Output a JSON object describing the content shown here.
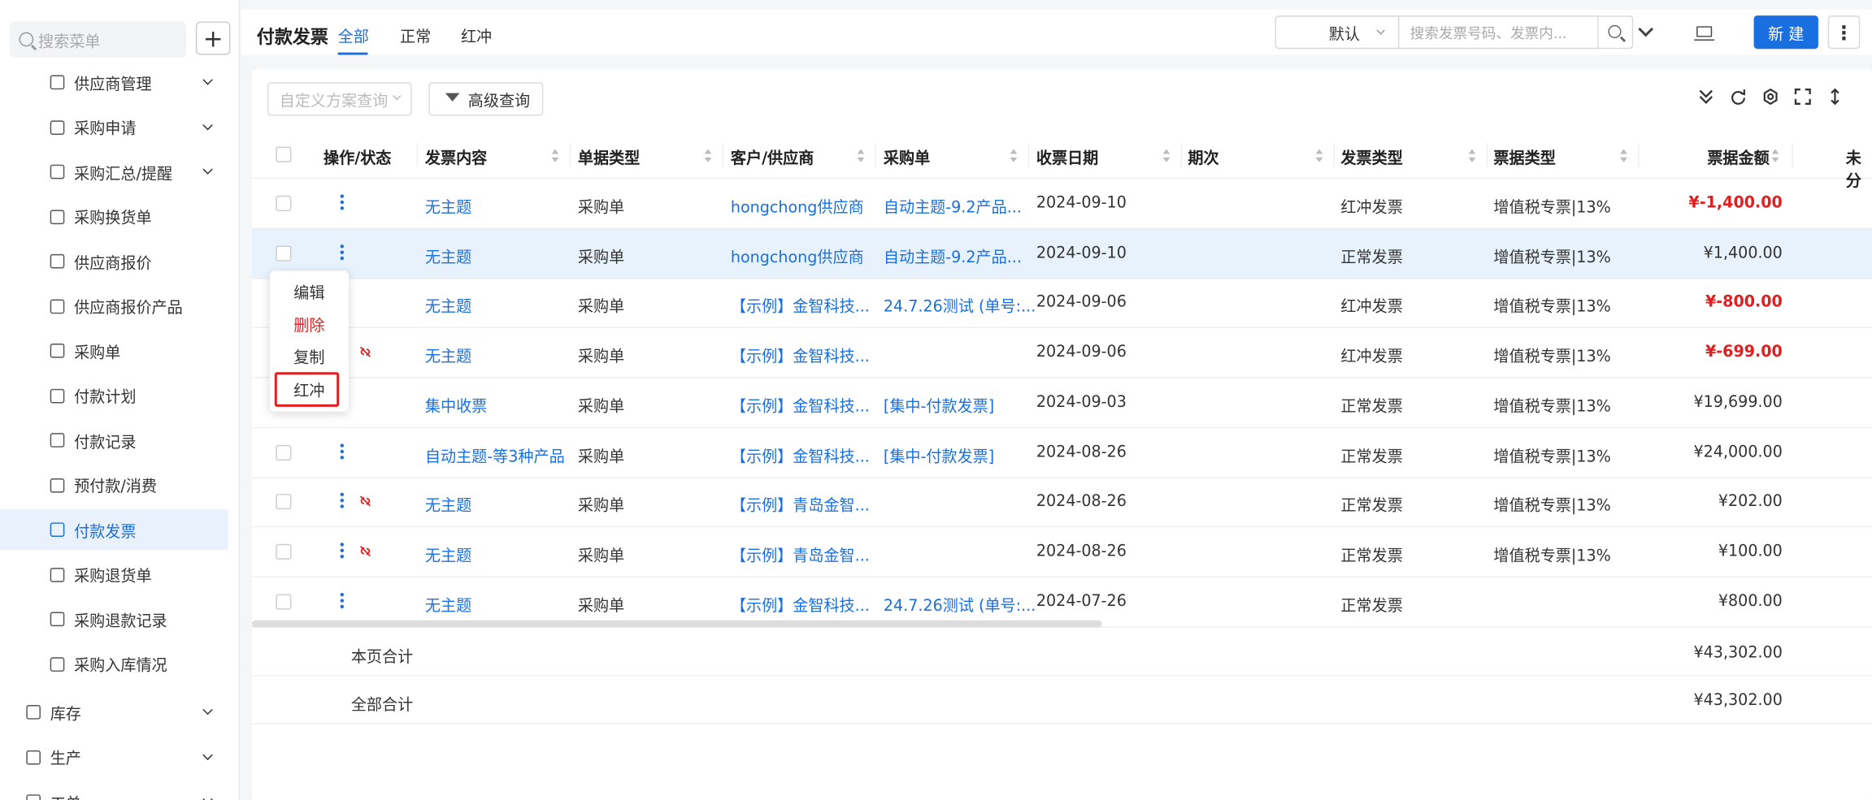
{
  "sidebar": {
    "search_placeholder": "搜索菜单",
    "add_label": "+",
    "items": [
      {
        "label": "供应商管理",
        "has_children": true
      },
      {
        "label": "采购申请",
        "has_children": true
      },
      {
        "label": "采购汇总/提醒",
        "has_children": true
      },
      {
        "label": "采购换货单",
        "has_children": false
      },
      {
        "label": "供应商报价",
        "has_children": false
      },
      {
        "label": "供应商报价产品",
        "has_children": false
      },
      {
        "label": "采购单",
        "has_children": false
      },
      {
        "label": "付款计划",
        "has_children": false
      },
      {
        "label": "付款记录",
        "has_children": false
      },
      {
        "label": "预付款/消费",
        "has_children": false
      },
      {
        "label": "付款发票",
        "has_children": false,
        "active": true
      },
      {
        "label": "采购退货单",
        "has_children": false
      },
      {
        "label": "采购退款记录",
        "has_children": false
      },
      {
        "label": "采购入库情况",
        "has_children": false
      }
    ],
    "top_items": [
      {
        "label": "库存"
      },
      {
        "label": "生产"
      },
      {
        "label": "工单"
      }
    ]
  },
  "header": {
    "title": "付款发票",
    "tabs": [
      "全部",
      "正常",
      "红冲"
    ],
    "active_tab": "全部",
    "view_select": "默认",
    "search_placeholder": "搜索发票号码、发票内...",
    "new_button": "新 建",
    "more_button": "⋮"
  },
  "toolbar": {
    "scheme_placeholder": "自定义方案查询",
    "advanced_query": "高级查询"
  },
  "table": {
    "columns": [
      "操作/状态",
      "发票内容",
      "单据类型",
      "客户/供应商",
      "采购单",
      "收票日期",
      "期次",
      "发票类型",
      "票据类型",
      "票据金额",
      "未分"
    ],
    "rows": [
      {
        "content": "无主题",
        "doc_type": "采购单",
        "supplier": "hongchong供应商",
        "po": "自动主题-9.2产品...",
        "date": "2024-09-10",
        "period": "",
        "inv_type": "红冲发票",
        "bill_type": "增值税专票|13%",
        "amount": "¥-1,400.00",
        "negative": true,
        "unlinked": false,
        "highlight": false
      },
      {
        "content": "无主题",
        "doc_type": "采购单",
        "supplier": "hongchong供应商",
        "po": "自动主题-9.2产品...",
        "date": "2024-09-10",
        "period": "",
        "inv_type": "正常发票",
        "bill_type": "增值税专票|13%",
        "amount": "¥1,400.00",
        "negative": false,
        "unlinked": false,
        "highlight": true
      },
      {
        "content": "无主题",
        "doc_type": "采购单",
        "supplier": "【示例】金智科技...",
        "po": "24.7.26测试 (单号:...",
        "date": "2024-09-06",
        "period": "",
        "inv_type": "红冲发票",
        "bill_type": "增值税专票|13%",
        "amount": "¥-800.00",
        "negative": true,
        "unlinked": false,
        "highlight": false
      },
      {
        "content": "无主题",
        "doc_type": "采购单",
        "supplier": "【示例】金智科技...",
        "po": "",
        "date": "2024-09-06",
        "period": "",
        "inv_type": "红冲发票",
        "bill_type": "增值税专票|13%",
        "amount": "¥-699.00",
        "negative": true,
        "unlinked": true,
        "highlight": false
      },
      {
        "content": "集中收票",
        "doc_type": "采购单",
        "supplier": "【示例】金智科技...",
        "po": "[集中-付款发票]",
        "date": "2024-09-03",
        "period": "",
        "inv_type": "正常发票",
        "bill_type": "增值税专票|13%",
        "amount": "¥19,699.00",
        "negative": false,
        "unlinked": false,
        "highlight": false
      },
      {
        "content": "自动主题-等3种产品",
        "doc_type": "采购单",
        "supplier": "【示例】金智科技...",
        "po": "[集中-付款发票]",
        "date": "2024-08-26",
        "period": "",
        "inv_type": "正常发票",
        "bill_type": "增值税专票|13%",
        "amount": "¥24,000.00",
        "negative": false,
        "unlinked": false,
        "highlight": false
      },
      {
        "content": "无主题",
        "doc_type": "采购单",
        "supplier": "【示例】青岛金智...",
        "po": "",
        "date": "2024-08-26",
        "period": "",
        "inv_type": "正常发票",
        "bill_type": "增值税专票|13%",
        "amount": "¥202.00",
        "negative": false,
        "unlinked": true,
        "highlight": false
      },
      {
        "content": "无主题",
        "doc_type": "采购单",
        "supplier": "【示例】青岛金智...",
        "po": "",
        "date": "2024-08-26",
        "period": "",
        "inv_type": "正常发票",
        "bill_type": "增值税专票|13%",
        "amount": "¥100.00",
        "negative": false,
        "unlinked": true,
        "highlight": false
      },
      {
        "content": "无主题",
        "doc_type": "采购单",
        "supplier": "【示例】金智科技...",
        "po": "24.7.26测试 (单号:...",
        "date": "2024-07-26",
        "period": "",
        "inv_type": "正常发票",
        "bill_type": "",
        "amount": "¥800.00",
        "negative": false,
        "unlinked": false,
        "highlight": false
      }
    ],
    "summary": [
      {
        "label": "本页合计",
        "amount": "¥43,302.00"
      },
      {
        "label": "全部合计",
        "amount": "¥43,302.00"
      }
    ]
  },
  "context_menu": {
    "items": [
      "编辑",
      "删除",
      "复制",
      "红冲"
    ],
    "highlighted": "红冲"
  },
  "colors": {
    "accent": "#1a6fe0",
    "danger": "#e02020",
    "row_highlight": "#e8f2fd"
  }
}
